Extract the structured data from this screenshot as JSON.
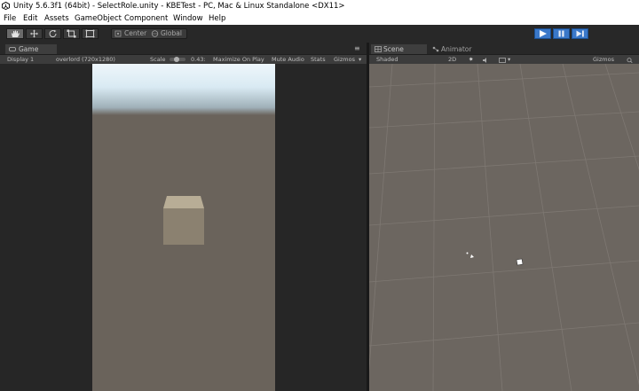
{
  "window": {
    "title": "Unity 5.6.3f1 (64bit) - SelectRole.unity - KBETest - PC, Mac & Linux Standalone <DX11>"
  },
  "menu": [
    "File",
    "Edit",
    "Assets",
    "GameObject",
    "Component",
    "Window",
    "Help"
  ],
  "toolbar": {
    "tools": [
      "hand-icon",
      "move-icon",
      "rotate-icon",
      "scale-icon",
      "rect-icon"
    ],
    "pivot_mode": "Center",
    "pivot_rotation": "Global",
    "playback": [
      "play-icon",
      "pause-icon",
      "step-icon"
    ]
  },
  "game_panel": {
    "tab": "Game",
    "display": "Display 1",
    "resolution": "overlord (720x1280)",
    "scale_label": "Scale",
    "scale_value": "0.43:",
    "maximize": "Maximize On Play",
    "mute": "Mute Audio",
    "stats": "Stats",
    "gizmos": "Gizmos"
  },
  "scene_panel": {
    "tabs": [
      "Scene",
      "Animator"
    ],
    "draw_mode": "Shaded",
    "mode_2d": "2D",
    "gizmos": "Gizmos"
  },
  "colors": {
    "play_accent": "#3a78c9",
    "game_ground": "#6a635b",
    "scene_ground": "#6c6660"
  }
}
